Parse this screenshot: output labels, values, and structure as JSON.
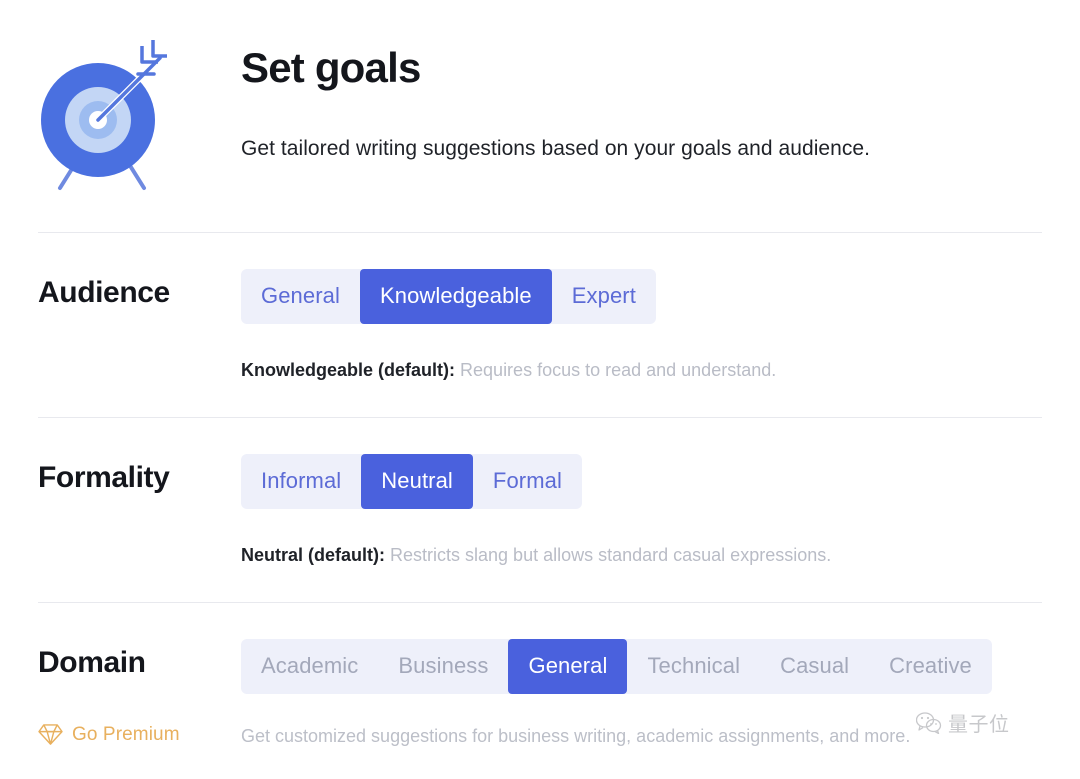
{
  "header": {
    "title": "Set goals",
    "subtitle": "Get tailored writing suggestions based on your goals and audience.",
    "icon": "target-with-arrow-icon"
  },
  "colors": {
    "accent_selected": "#4a61dd",
    "segment_background": "#eef0fa",
    "segment_text": "#5c6bd6",
    "segment_text_locked": "#a3a8ba",
    "premium_gold": "#e8b05e",
    "divider": "#e8e9ee",
    "heading": "#14161c",
    "muted_text": "#b9bcc6",
    "page_background": "#ffffff"
  },
  "settings": [
    {
      "label": "Audience",
      "name": "audience",
      "locked": false,
      "options": [
        "General",
        "Knowledgeable",
        "Expert"
      ],
      "selected": "Knowledgeable",
      "description_strong": "Knowledgeable (default):",
      "description_muted": "Requires focus to read and understand."
    },
    {
      "label": "Formality",
      "name": "formality",
      "locked": false,
      "options": [
        "Informal",
        "Neutral",
        "Formal"
      ],
      "selected": "Neutral",
      "description_strong": "Neutral (default):",
      "description_muted": "Restricts slang but allows standard casual expressions."
    },
    {
      "label": "Domain",
      "name": "domain",
      "locked": true,
      "options": [
        "Academic",
        "Business",
        "General",
        "Technical",
        "Casual",
        "Creative"
      ],
      "selected": "General",
      "description_strong": "",
      "description_muted": ""
    }
  ],
  "premium": {
    "label": "Go Premium",
    "icon": "diamond-gem-icon",
    "description": "Get customized suggestions for business writing, academic assignments, and more."
  },
  "watermark": {
    "text": "量子位",
    "icon": "wechat-logo-icon"
  }
}
